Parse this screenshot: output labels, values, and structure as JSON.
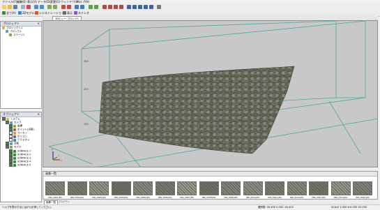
{
  "menubar": {
    "items": [
      "ファイル(F)",
      "編集(E)",
      "表示(V)",
      "データ(D)",
      "変更(G)",
      "ウィンドウ(W)",
      "ヘルプ(H)"
    ]
  },
  "modes": {
    "items": [
      "全て(A)",
      "2Dモデル",
      "レジストレーション",
      "表示",
      "ステレオ"
    ]
  },
  "project_panel": {
    "title": "プロジェクト",
    "tree": [
      "プロジェクト1",
      "ブロック1",
      "ステージ1"
    ]
  },
  "object_panel": {
    "title": "オブジェクト",
    "tree": [
      "システム",
      "カメラ",
      "座標",
      "ポイント(点群)",
      "マーカー",
      "ポリゴン",
      "テクスチャ",
      "点群",
      "モデル",
      "SURFACE-1",
      "SURFACE-2",
      "SURFACE-3",
      "SURFACE-4",
      "SURFACE-5"
    ]
  },
  "viewport": {
    "tab_label": "3Dビュー: ブロック1",
    "axis_labels": [
      "300",
      "200",
      "100"
    ],
    "axes": {
      "x": "X",
      "y": "Y",
      "z": "Z"
    }
  },
  "image_list": {
    "title": "画像一覧",
    "bottom_tabs": [
      "画像一覧",
      "プロパティ"
    ],
    "thumbnails": [
      "IMG_0001.JPG",
      "IMG_0002.JPG",
      "IMG_0003.JPG",
      "IMG_0004.JPG",
      "IMG_0005.JPG",
      "IMG_0006.JPG",
      "IMG_0007.JPG",
      "IMG_0008.JPG",
      "IMG_0009.JPG",
      "IMG_0010.JPG",
      "IMG_0011.JPG",
      "IMG_0012.JPG",
      "IMG_0013.JPG",
      "IMG_0014.JPG",
      "IMG_0015.JPG"
    ]
  },
  "status": {
    "left": "ヘルプを表示するには[F1]を押してください。",
    "coords": "選択数: 40,400 0.000 -40,400",
    "right": "SCALE 1.000 X:0.000 Y:0.000"
  },
  "colors": {
    "viewport_bg": "#c8c8c8",
    "bbox_line": "#4da8a0",
    "wall_dark": "#4a4a4a",
    "wall_light": "#8a8a7e"
  }
}
